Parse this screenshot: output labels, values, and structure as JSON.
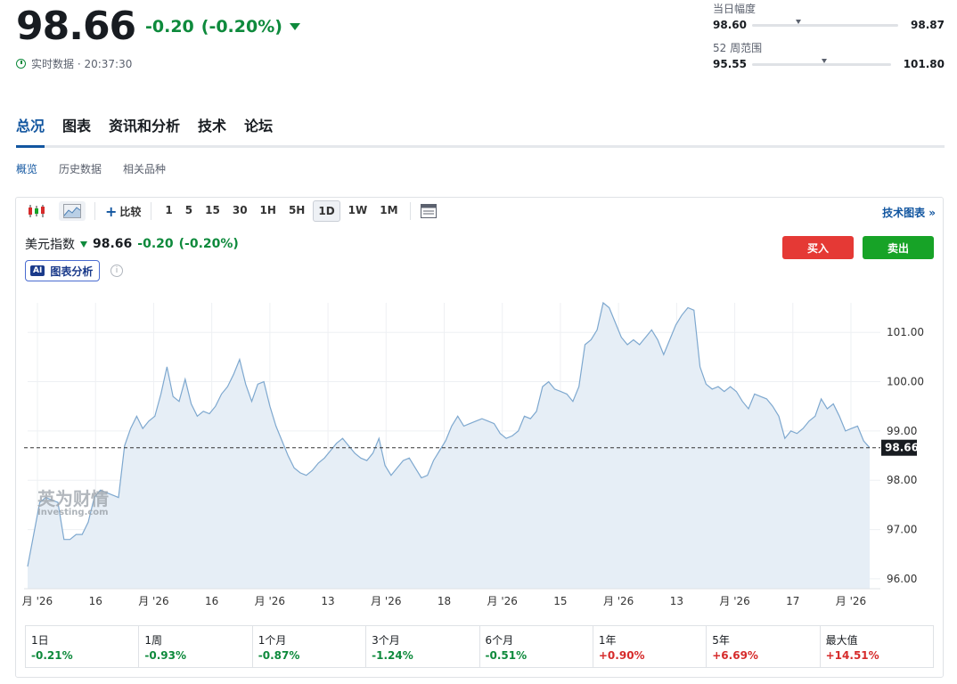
{
  "quote": {
    "price": "98.66",
    "change": "-0.20",
    "change_pct": "(-0.20%)",
    "realtime_label": "实时数据 · 20:37:30"
  },
  "day_range": {
    "label": "当日幅度",
    "low": "98.60",
    "high": "98.87",
    "position": 0.3
  },
  "week52_range": {
    "label": "52 周范围",
    "low": "95.55",
    "high": "101.80",
    "position": 0.5
  },
  "tabs": [
    "总况",
    "图表",
    "资讯和分析",
    "技术",
    "论坛"
  ],
  "subtabs": [
    "概览",
    "历史数据",
    "相关品种"
  ],
  "toolbar": {
    "compare": "比较",
    "periods": [
      "1",
      "5",
      "15",
      "30",
      "1H",
      "5H",
      "1D",
      "1W",
      "1M"
    ],
    "active_period": "1D",
    "tech_chart": "技术图表 »"
  },
  "instrument": {
    "name": "美元指数",
    "price": "98.66",
    "change": "-0.20",
    "change_pct": "(-0.20%)"
  },
  "ai_button": {
    "badge": "AI",
    "label": "图表分析"
  },
  "info_icon": "i",
  "buy_label": "买入",
  "sell_label": "卖出",
  "watermark": {
    "main": "英为财情",
    "sub": "Investing.com"
  },
  "colors": {
    "down": "#0e8a3c",
    "up": "#d62b2b",
    "accent": "#1256a0",
    "line": "#7ea8cf",
    "area": "#e6eef6"
  },
  "chart_data": {
    "type": "area",
    "y_ticks": [
      "96.00",
      "97.00",
      "98.00",
      "99.00",
      "100.00",
      "101.00"
    ],
    "ylim": [
      95.8,
      101.6
    ],
    "x_ticks": [
      "月 '26",
      "16",
      "月 '26",
      "16",
      "月 '26",
      "13",
      "月 '26",
      "18",
      "月 '26",
      "15",
      "月 '26",
      "13",
      "月 '26",
      "17",
      "月 '26"
    ],
    "last_value_label": "98.66",
    "last_value": 98.66,
    "values": [
      96.25,
      96.9,
      97.55,
      97.65,
      97.6,
      97.55,
      96.8,
      96.8,
      96.9,
      96.9,
      97.15,
      97.65,
      97.8,
      97.75,
      97.7,
      97.65,
      98.7,
      99.05,
      99.3,
      99.05,
      99.2,
      99.3,
      99.75,
      100.3,
      99.7,
      99.6,
      100.05,
      99.55,
      99.3,
      99.4,
      99.35,
      99.5,
      99.75,
      99.9,
      100.15,
      100.45,
      99.95,
      99.6,
      99.95,
      100.0,
      99.5,
      99.1,
      98.8,
      98.5,
      98.25,
      98.15,
      98.1,
      98.2,
      98.35,
      98.45,
      98.6,
      98.75,
      98.85,
      98.7,
      98.55,
      98.45,
      98.4,
      98.55,
      98.85,
      98.3,
      98.1,
      98.25,
      98.4,
      98.45,
      98.25,
      98.05,
      98.1,
      98.4,
      98.6,
      98.8,
      99.1,
      99.3,
      99.1,
      99.15,
      99.2,
      99.25,
      99.2,
      99.15,
      98.95,
      98.85,
      98.9,
      99.0,
      99.3,
      99.25,
      99.4,
      99.9,
      100.0,
      99.85,
      99.8,
      99.75,
      99.6,
      99.9,
      100.75,
      100.85,
      101.05,
      101.6,
      101.5,
      101.2,
      100.9,
      100.75,
      100.85,
      100.75,
      100.9,
      101.05,
      100.85,
      100.55,
      100.85,
      101.15,
      101.35,
      101.5,
      101.45,
      100.3,
      99.95,
      99.85,
      99.9,
      99.8,
      99.9,
      99.8,
      99.6,
      99.45,
      99.75,
      99.7,
      99.65,
      99.5,
      99.3,
      98.85,
      99.0,
      98.95,
      99.05,
      99.2,
      99.3,
      99.65,
      99.45,
      99.55,
      99.3,
      99.0,
      99.05,
      99.1,
      98.8,
      98.66
    ]
  },
  "performance": [
    {
      "label": "1日",
      "value": "-0.21%",
      "dir": "neg"
    },
    {
      "label": "1周",
      "value": "-0.93%",
      "dir": "neg"
    },
    {
      "label": "1个月",
      "value": "-0.87%",
      "dir": "neg"
    },
    {
      "label": "3个月",
      "value": "-1.24%",
      "dir": "neg"
    },
    {
      "label": "6个月",
      "value": "-0.51%",
      "dir": "neg"
    },
    {
      "label": "1年",
      "value": "+0.90%",
      "dir": "pos"
    },
    {
      "label": "5年",
      "value": "+6.69%",
      "dir": "pos"
    },
    {
      "label": "最大值",
      "value": "+14.51%",
      "dir": "pos"
    }
  ]
}
